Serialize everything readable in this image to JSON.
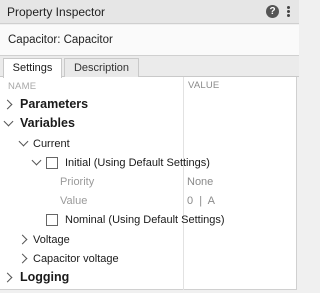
{
  "window": {
    "title": "Property Inspector"
  },
  "component": {
    "label": "Capacitor: Capacitor"
  },
  "tabs": [
    {
      "label": "Settings",
      "active": true
    },
    {
      "label": "Description",
      "active": false
    }
  ],
  "columns": {
    "name": "NAME",
    "value": "VALUE"
  },
  "tree": {
    "parameters": "Parameters",
    "variables": "Variables",
    "current": "Current",
    "initial": "Initial (Using Default Settings)",
    "priority_label": "Priority",
    "priority_value": "None",
    "value_label": "Value",
    "value_value": "0  |  A",
    "nominal": "Nominal (Using Default Settings)",
    "voltage": "Voltage",
    "capacitor_voltage": "Capacitor voltage",
    "logging": "Logging"
  },
  "icons": {
    "help": "help-icon",
    "menu": "kebab-menu-icon"
  },
  "colors": {
    "panel_background": "#f0f0f0",
    "grid_background": "#ffffff",
    "help_icon": "#555555"
  }
}
